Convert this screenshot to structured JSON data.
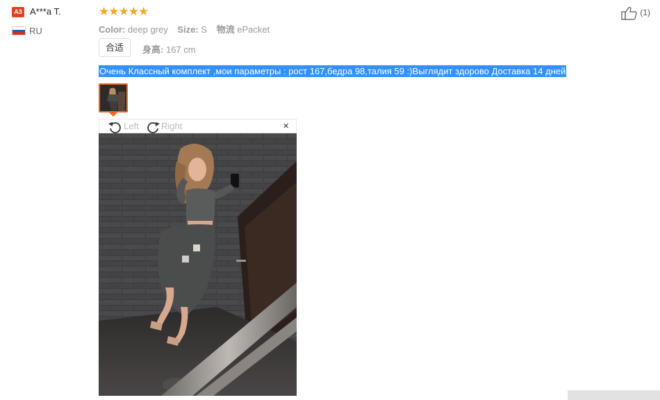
{
  "user": {
    "level_badge": "A3",
    "name": "A***a T.",
    "country": "RU",
    "flag_colors": [
      "#ffffff",
      "#2a5db0",
      "#d52b1e"
    ]
  },
  "review": {
    "rating_stars": "★★★★★",
    "rating": 5,
    "color_label": "Color:",
    "color_value": "deep grey",
    "size_label": "Size:",
    "size_value": "S",
    "logistics_label": "物流",
    "logistics_value": "ePacket",
    "fit_label": "合适",
    "height_label": "身高:",
    "height_value": "167 cm",
    "feedback_text": "Очень Классный комплект ,мои параметры : рост 167,бедра 98,талия 59 :)Выглядит здорово Доставка 14 дней",
    "likes_count": "(1)"
  },
  "viewer": {
    "rotate_left_label": "Left",
    "rotate_right_label": "Right",
    "close_symbol": "×",
    "icons": [
      "rotate-left-icon",
      "rotate-right-icon",
      "close-icon",
      "thumbs-up-icon"
    ]
  },
  "colors": {
    "accent": "#f06a20",
    "star": "#f5a623",
    "selection": "#3390ff",
    "badge": "#e0421f"
  }
}
